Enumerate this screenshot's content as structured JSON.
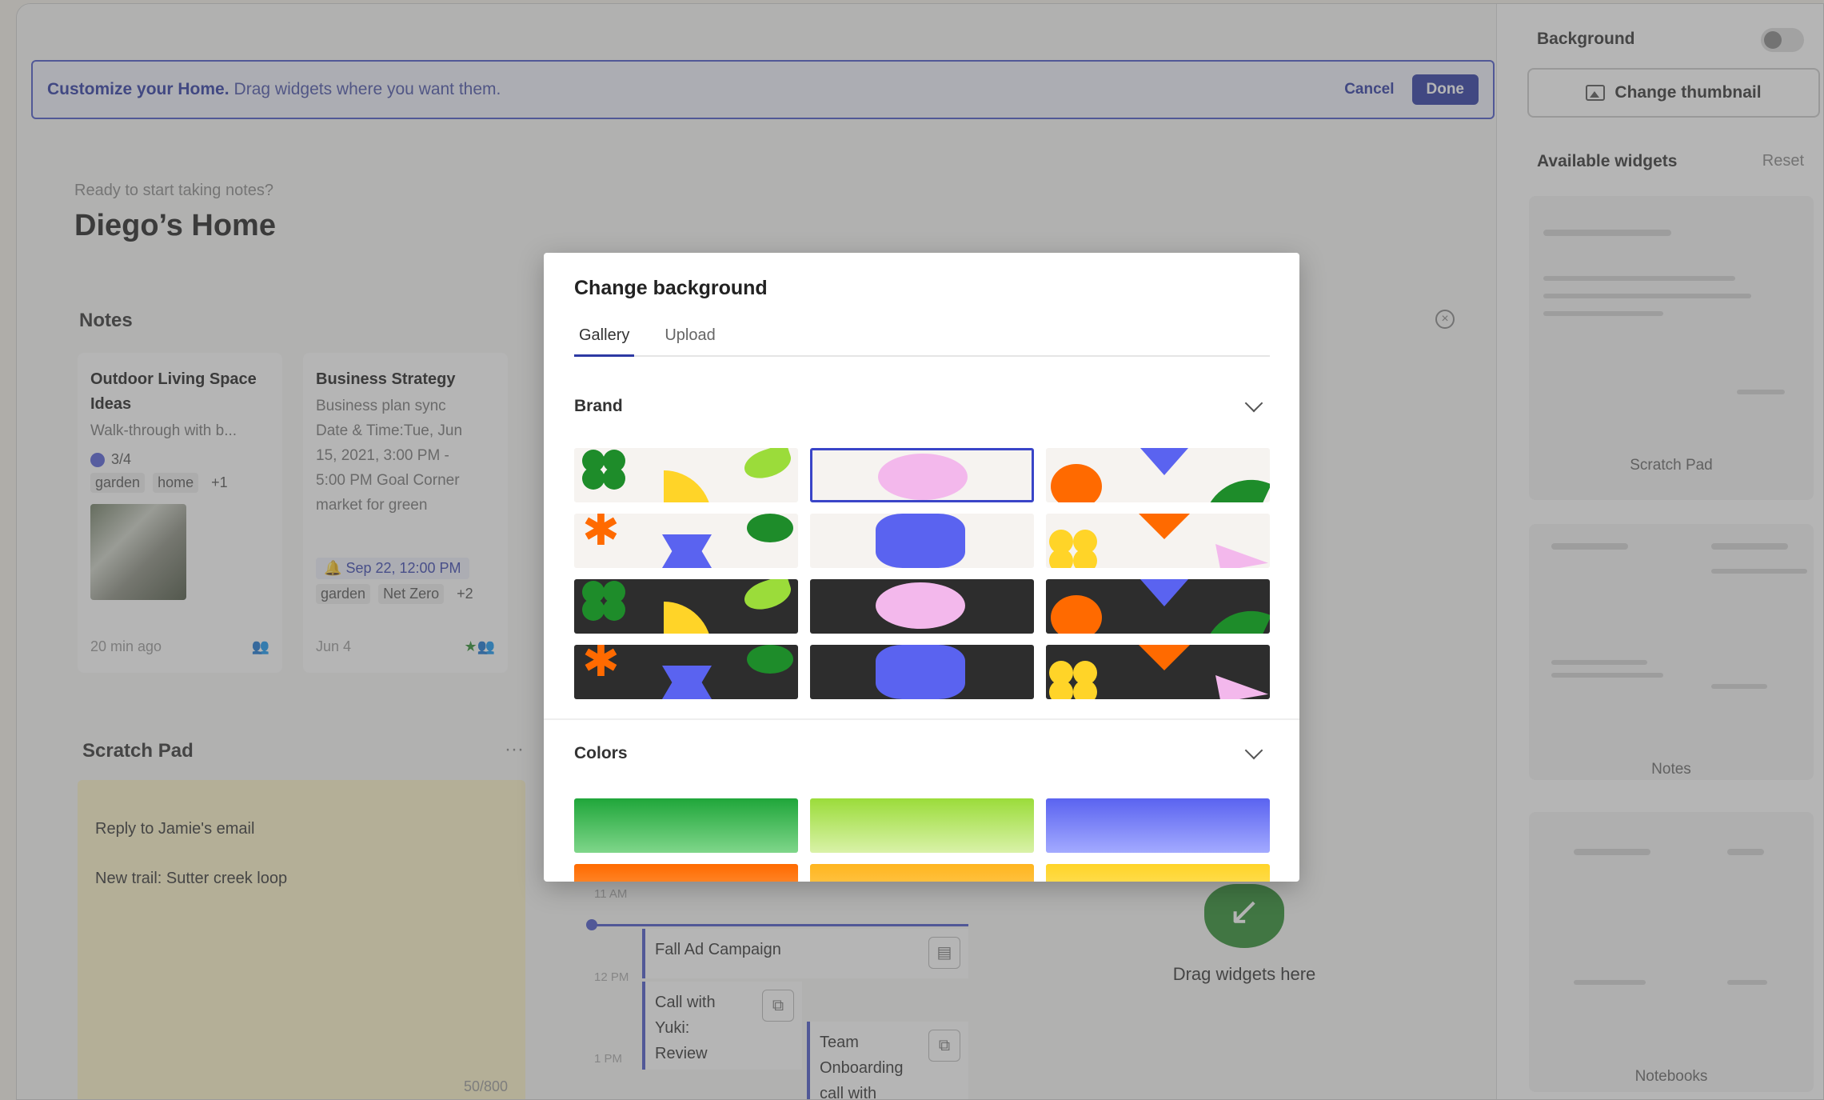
{
  "banner": {
    "title": "Customize your Home.",
    "description": "Drag widgets where you want them.",
    "cancel": "Cancel",
    "done": "Done"
  },
  "home": {
    "subtitle": "Ready to start taking notes?",
    "title": "Diego’s Home"
  },
  "notes": {
    "heading": "Notes",
    "cards": [
      {
        "title_line1": "Outdoor Living Space",
        "title_line2": "Ideas",
        "body": "Walk-through with b...",
        "task": "3/4",
        "tags": [
          "garden",
          "home",
          "+1"
        ],
        "time": "20 min ago"
      },
      {
        "title_line1": "Business Strategy",
        "body": [
          "Business plan sync",
          "Date & Time:Tue, Jun",
          "15, 2021, 3:00 PM -",
          "5:00 PM Goal Corner",
          "market for green"
        ],
        "reminder": "Sep 22, 12:00 PM",
        "tags": [
          "garden",
          "Net Zero",
          "+2"
        ],
        "time": "Jun 4"
      }
    ]
  },
  "scratch": {
    "heading": "Scratch Pad",
    "more": "···",
    "lines": [
      "Reply to Jamie's email",
      "New trail: Sutter creek loop"
    ],
    "count": "50/800"
  },
  "calendar": {
    "times": [
      "11 AM",
      "12 PM",
      "1 PM"
    ],
    "events": [
      {
        "label": "Fall Ad Campaign"
      },
      {
        "lines": [
          "Call with",
          "Yuki:",
          "Review"
        ]
      },
      {
        "lines": [
          "Team",
          "Onboarding",
          "call with"
        ]
      }
    ]
  },
  "drop": {
    "label": "Drag widgets here"
  },
  "right_panel": {
    "background_label": "Background",
    "change_thumbnail": "Change thumbnail",
    "available_widgets": "Available widgets",
    "reset": "Reset",
    "widgets": [
      "Scratch Pad",
      "Notes",
      "Notebooks"
    ]
  },
  "modal": {
    "title": "Change background",
    "tabs": [
      "Gallery",
      "Upload"
    ],
    "sections": [
      "Brand",
      "Colors"
    ]
  },
  "colors": {
    "green_dark": "#1e8c2a",
    "green_light": "#9bdc3a",
    "blue": "#5a63f0",
    "orange": "#ff6a00",
    "yellow": "#ffd428",
    "pink": "#f3b8ec",
    "accent": "#2d39a3"
  },
  "icons": [
    "search-icon",
    "image-icon",
    "close-circle-icon",
    "chevron-down-icon",
    "note-icon",
    "copy-icon",
    "shared-users-icon"
  ]
}
